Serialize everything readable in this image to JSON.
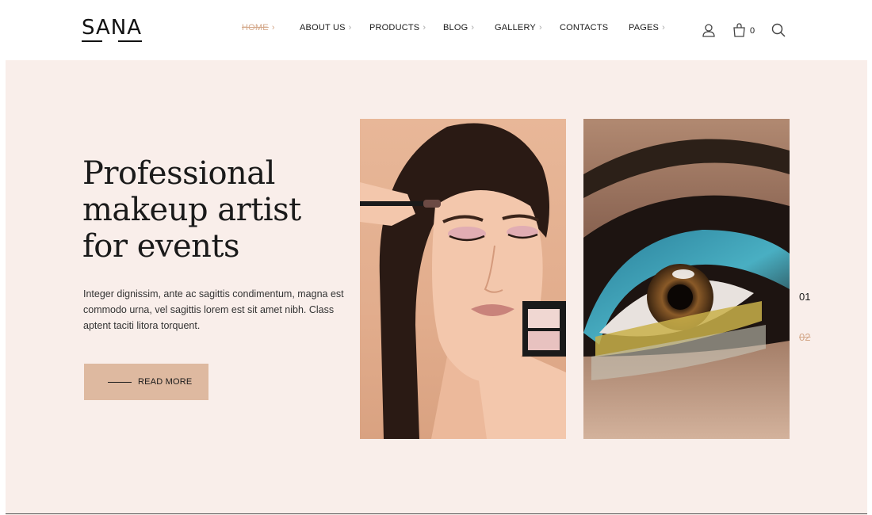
{
  "brand": {
    "logo": "SANA"
  },
  "nav": {
    "items": [
      {
        "label": "HOME",
        "chevron": "›",
        "active": true
      },
      {
        "label": "ABOUT US",
        "chevron": "›"
      },
      {
        "label": "PRODUCTS",
        "chevron": "›"
      },
      {
        "label": "BLOG",
        "chevron": "›"
      },
      {
        "label": "GALLERY",
        "chevron": "›"
      },
      {
        "label": "CONTACTS",
        "chevron": ""
      },
      {
        "label": "PAGES",
        "chevron": "›"
      }
    ]
  },
  "header_icons": {
    "account": "user-icon",
    "cart": "shopping-bag-icon",
    "cart_count": "0",
    "search": "search-icon"
  },
  "hero": {
    "headline": [
      "Professional",
      "makeup artist",
      "for events"
    ],
    "body": "Integer dignissim, ante ac sagittis condimentum, magna est commodo urna, vel sagittis lorem est sit amet nibh. Class aptent taciti litora torquent.",
    "button_label": "READ MORE",
    "slides": [
      "01",
      "02"
    ]
  },
  "colors": {
    "accent": "#d4a88a",
    "button_bg": "#deb9a0",
    "hero_bg": "#f9eeea",
    "text": "#1a1a1a"
  }
}
